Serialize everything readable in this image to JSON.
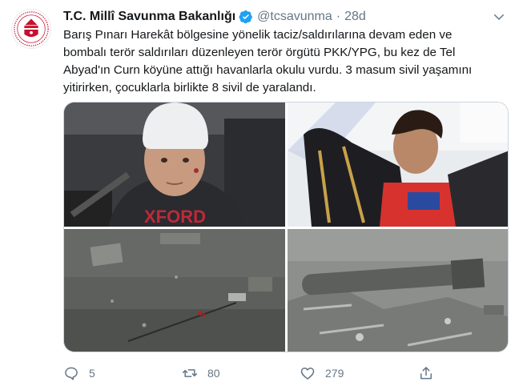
{
  "account": {
    "name": "T.C. Millî Savunma Bakanlığı",
    "handle": "@tcsavunma",
    "separator": "·",
    "time": "28d"
  },
  "tweet": {
    "text": "Barış Pınarı Harekât bölgesine yönelik taciz/saldırılarına devam eden ve\nbombalı terör saldırıları düzenleyen terör örgütü PKK/YPG, bu kez de Tel\nAbyad'ın Curn köyüne attığı havanlarla okulu vurdu. 3 masum sivil yaşamını\nyitirirken, çocuklarla birlikte 8 sivil de yaralandı.",
    "shirt_print": "XFORD"
  },
  "actions": {
    "replies": "5",
    "retweets": "80",
    "likes": "279"
  },
  "colors": {
    "verified": "#1da1f2",
    "action_icon": "#657786",
    "logo_red": "#c8102e"
  },
  "icons": {
    "verified": "verified-badge-icon",
    "caret": "chevron-down-icon",
    "reply": "reply-icon",
    "retweet": "retweet-icon",
    "like": "heart-icon",
    "share": "share-icon"
  }
}
